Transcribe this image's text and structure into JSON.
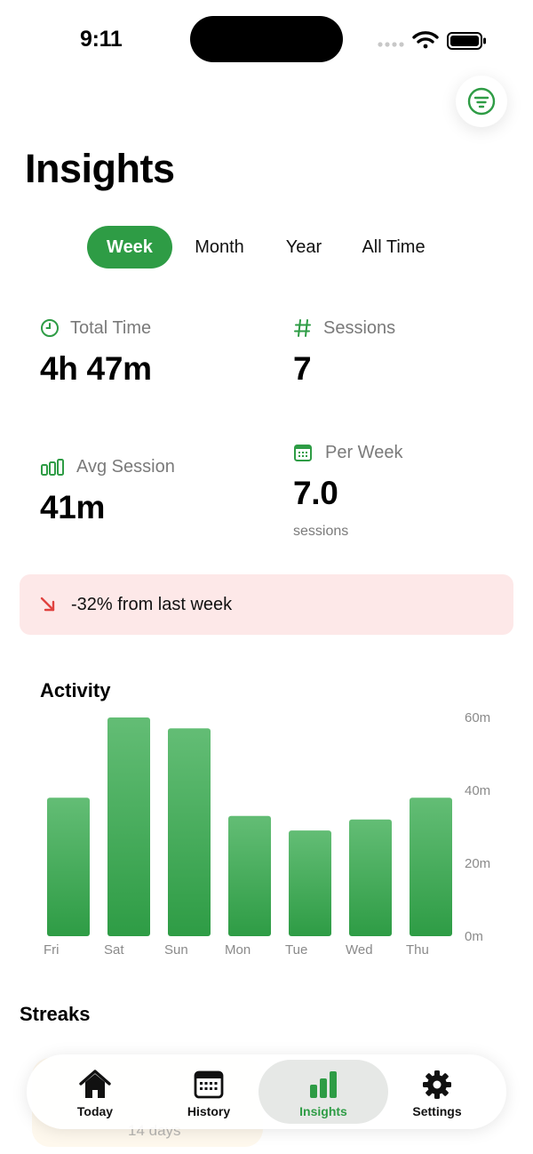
{
  "status": {
    "time": "9:11"
  },
  "header": {
    "title": "Insights"
  },
  "range": {
    "options": [
      "Week",
      "Month",
      "Year",
      "All Time"
    ],
    "selected": "Week"
  },
  "stats": {
    "total_time": {
      "label": "Total Time",
      "value": "4h 47m",
      "icon": "clock-icon"
    },
    "sessions": {
      "label": "Sessions",
      "value": "7",
      "icon": "hash-icon"
    },
    "avg_session": {
      "label": "Avg Session",
      "value": "41m",
      "icon": "bars-icon"
    },
    "per_week": {
      "label": "Per Week",
      "value": "7.0",
      "sub": "sessions",
      "icon": "calendar-icon"
    }
  },
  "trend": {
    "text": "-32% from last week",
    "direction": "down",
    "icon": "arrow-down-right-icon"
  },
  "activity": {
    "title": "Activity"
  },
  "chart_data": {
    "type": "bar",
    "categories": [
      "Fri",
      "Sat",
      "Sun",
      "Mon",
      "Tue",
      "Wed",
      "Thu"
    ],
    "values": [
      38,
      60,
      57,
      33,
      29,
      32,
      38
    ],
    "ylim": [
      0,
      60
    ],
    "yticks": [
      "0m",
      "20m",
      "40m",
      "60m"
    ],
    "tick_values": [
      0,
      20,
      40,
      60
    ],
    "unit": "minutes",
    "color": "#2e9c45"
  },
  "streaks": {
    "title": "Streaks",
    "ghost_value": "14 days"
  },
  "tabbar": {
    "items": [
      {
        "label": "Today",
        "icon": "house-icon"
      },
      {
        "label": "History",
        "icon": "calendar-grid-icon"
      },
      {
        "label": "Insights",
        "icon": "bar-chart-icon"
      },
      {
        "label": "Settings",
        "icon": "gear-icon"
      }
    ],
    "active": "Insights"
  },
  "colors": {
    "accent": "#2e9c45",
    "negative": "#e0423f",
    "banner_bg": "#fde8e8"
  }
}
